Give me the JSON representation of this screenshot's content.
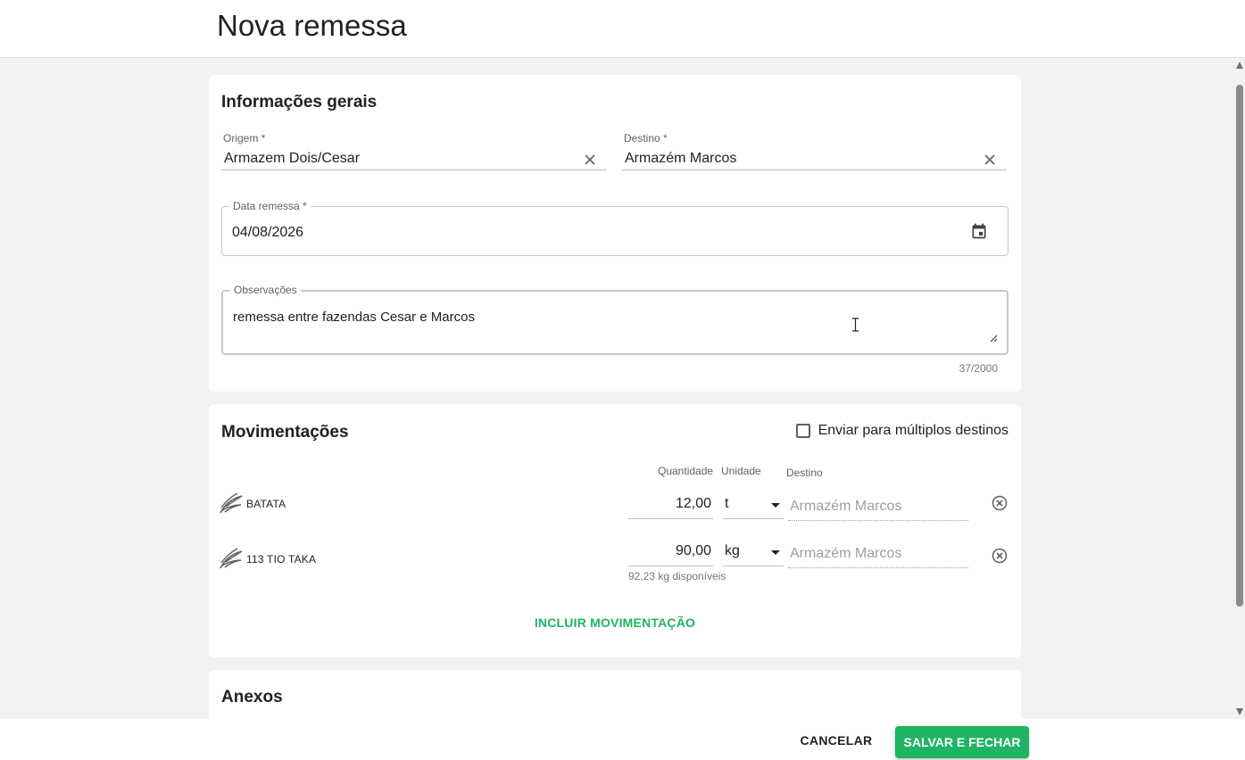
{
  "header": {
    "title": "Nova remessa"
  },
  "general_info": {
    "title": "Informações gerais",
    "origin": {
      "label": "Origem *",
      "value": "Armazem Dois/Cesar"
    },
    "destination": {
      "label": "Destino *",
      "value": "Armazém Marcos"
    },
    "shipment_date": {
      "label": "Data remessa *",
      "value": "04/08/2026"
    },
    "notes": {
      "label": "Observações",
      "value": "remessa entre fazendas Cesar e Marcos",
      "counter": "37/2000"
    }
  },
  "movements": {
    "title": "Movimentações",
    "multi_destination_label": "Enviar para múltiplos destinos",
    "multi_destination_checked": false,
    "columns": {
      "quantity": "Quantidade",
      "unit": "Unidade",
      "destination": "Destino"
    },
    "rows": [
      {
        "product": "BATATA",
        "quantity": "12,00",
        "unit": "t",
        "destination": "Armazém Marcos"
      },
      {
        "product": "113 TIO TAKA",
        "quantity": "90,00",
        "unit": "kg",
        "destination": "Armazém Marcos",
        "available": "92,23 kg disponíveis"
      }
    ],
    "add_label": "INCLUIR MOVIMENTAÇÃO"
  },
  "attachments": {
    "title": "Anexos"
  },
  "footer": {
    "cancel_label": "CANCELAR",
    "save_label": "SALVAR E FECHAR"
  },
  "colors": {
    "accent": "#1fb463",
    "background": "#f2f2f2"
  },
  "icons": {
    "clear": "close-icon",
    "date": "calendar-icon",
    "product": "leaf-icon",
    "remove": "remove-circle-icon"
  }
}
